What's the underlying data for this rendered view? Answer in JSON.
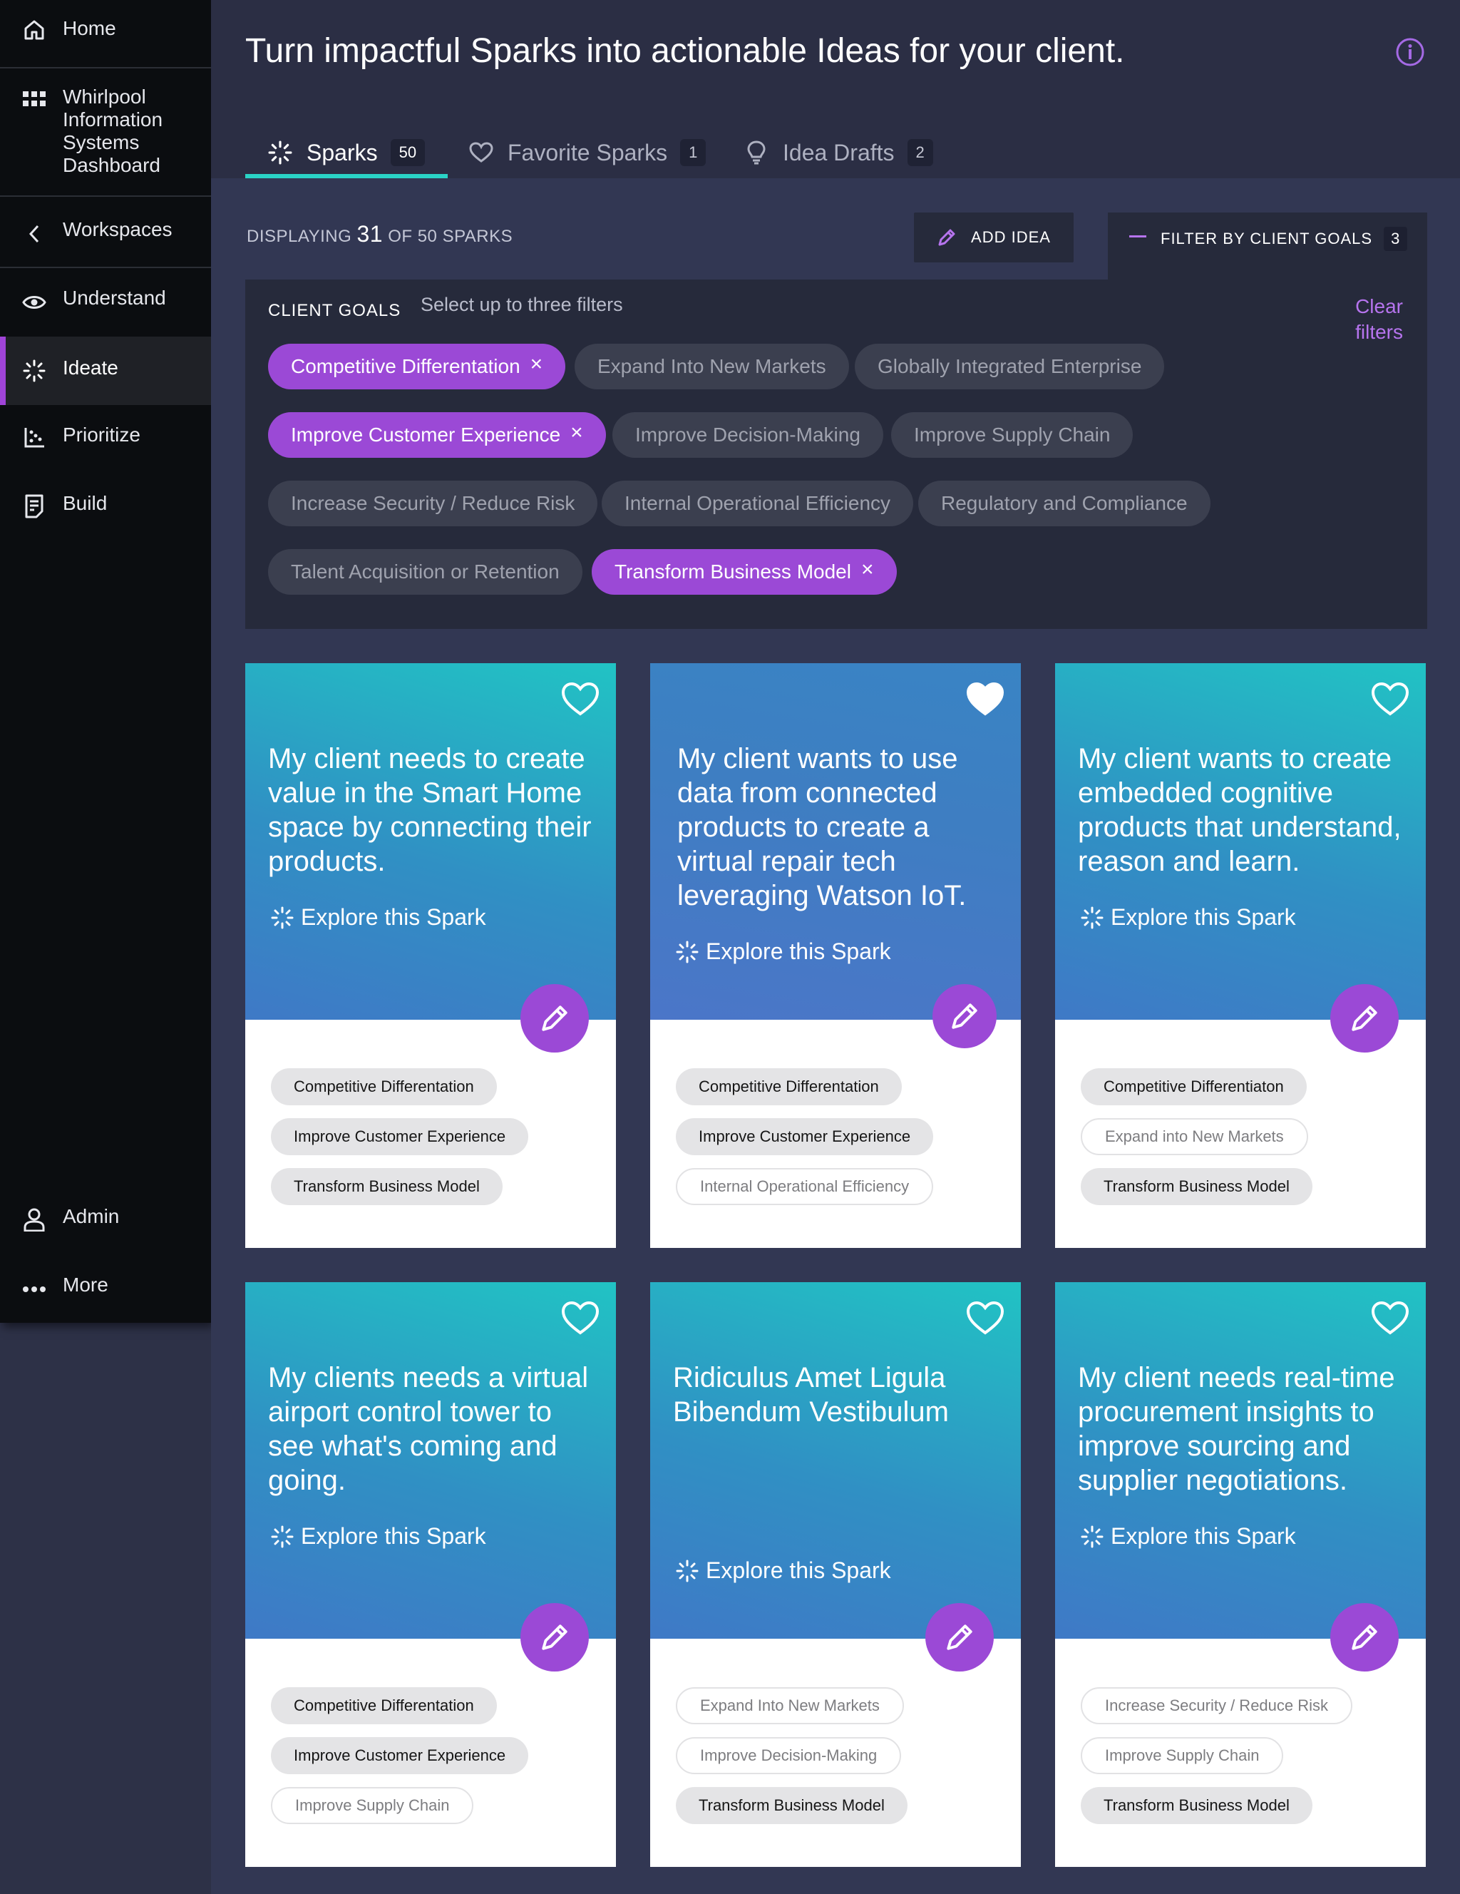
{
  "sidebar": {
    "items": [
      {
        "label": "Home",
        "icon": "home-icon"
      },
      {
        "label": "Whirlpool Information Systems Dashboard",
        "icon": "grid-icon"
      },
      {
        "label": "Workspaces",
        "icon": "chevron-left-icon"
      },
      {
        "label": "Understand",
        "icon": "eye-icon"
      },
      {
        "label": "Ideate",
        "icon": "spark-icon",
        "active": true
      },
      {
        "label": "Prioritize",
        "icon": "scatter-chart-icon"
      },
      {
        "label": "Build",
        "icon": "document-icon"
      }
    ],
    "bottom": [
      {
        "label": "Admin",
        "icon": "user-icon"
      },
      {
        "label": "More",
        "icon": "more-icon"
      }
    ]
  },
  "header": {
    "title": "Turn impactful Sparks into actionable Ideas for your client."
  },
  "tabs": [
    {
      "label": "Sparks",
      "count": "50",
      "active": true
    },
    {
      "label": "Favorite Sparks",
      "count": "1"
    },
    {
      "label": "Idea Drafts",
      "count": "2"
    }
  ],
  "toolbar": {
    "displaying_prefix": "DISPLAYING",
    "displaying_count": "31",
    "displaying_suffix": "OF 50 SPARKS",
    "add_idea": "ADD IDEA",
    "filter_label": "FILTER BY CLIENT GOALS",
    "filter_count": "3"
  },
  "filters": {
    "title": "CLIENT GOALS",
    "subtitle": "Select up to three filters",
    "clear": "Clear filters",
    "chips": [
      {
        "label": "Competitive Differentation",
        "selected": true
      },
      {
        "label": "Expand Into New Markets",
        "selected": false
      },
      {
        "label": "Globally Integrated Enterprise",
        "selected": false
      },
      {
        "label": "Improve Customer Experience",
        "selected": true
      },
      {
        "label": "Improve Decision-Making",
        "selected": false
      },
      {
        "label": "Improve Supply Chain",
        "selected": false
      },
      {
        "label": "Increase Security / Reduce Risk",
        "selected": false
      },
      {
        "label": "Internal Operational Efficiency",
        "selected": false
      },
      {
        "label": "Regulatory and Compliance",
        "selected": false
      },
      {
        "label": "Talent Acquisition or Retention",
        "selected": false
      },
      {
        "label": "Transform Business Model",
        "selected": true
      }
    ]
  },
  "cards": [
    {
      "title": "My client needs to create value in the Smart Home space by connecting their products.",
      "explore": "Explore this Spark",
      "favorite": false,
      "tags": [
        {
          "label": "Competitive Differentation",
          "selected": true
        },
        {
          "label": "Improve Customer Experience",
          "selected": true
        },
        {
          "label": "Transform Business Model",
          "selected": true
        }
      ]
    },
    {
      "title": "My client wants to use data from connected products to create a virtual repair tech leveraging Watson IoT.",
      "explore": "Explore this Spark",
      "favorite": true,
      "tags": [
        {
          "label": "Competitive Differentation",
          "selected": true
        },
        {
          "label": "Improve Customer Experience",
          "selected": true
        },
        {
          "label": "Internal Operational Efficiency",
          "selected": false
        }
      ]
    },
    {
      "title": "My client wants to create embedded cognitive products that understand, reason and learn.",
      "explore": "Explore this Spark",
      "favorite": false,
      "tags": [
        {
          "label": "Competitive Differentiaton",
          "selected": true
        },
        {
          "label": "Expand into New Markets",
          "selected": false
        },
        {
          "label": "Transform Business Model",
          "selected": true
        }
      ]
    },
    {
      "title": "My clients needs a virtual airport control tower to see what's coming and going.",
      "explore": "Explore this Spark",
      "favorite": false,
      "tags": [
        {
          "label": "Competitive Differentation",
          "selected": true
        },
        {
          "label": "Improve Customer Experience",
          "selected": true
        },
        {
          "label": "Improve Supply Chain",
          "selected": false
        }
      ]
    },
    {
      "title": "Ridiculus Amet Ligula Bibendum Vestibulum",
      "explore": "Explore this Spark",
      "favorite": false,
      "tags": [
        {
          "label": "Expand Into New Markets",
          "selected": false
        },
        {
          "label": "Improve Decision-Making",
          "selected": false
        },
        {
          "label": "Transform Business Model",
          "selected": true
        }
      ]
    },
    {
      "title": "My client needs real-time procurement insights to improve sourcing and supplier negotiations.",
      "explore": "Explore this Spark",
      "favorite": false,
      "tags": [
        {
          "label": "Increase Security / Reduce Risk",
          "selected": false
        },
        {
          "label": "Improve Supply Chain",
          "selected": false
        },
        {
          "label": "Transform Business Model",
          "selected": true
        }
      ]
    }
  ],
  "colors": {
    "accent": "#9b49d6",
    "teal": "#2ad3c6",
    "sidebar_bg": "#0b0d10",
    "page_bg": "#323753"
  }
}
